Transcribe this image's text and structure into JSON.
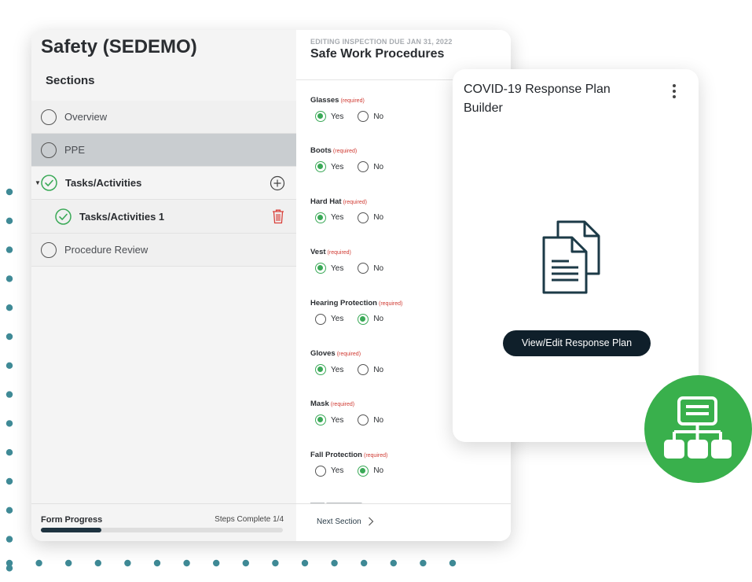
{
  "app": {
    "title": "Safety (SEDEMO)"
  },
  "sidebar": {
    "title": "Sections",
    "items": [
      {
        "label": "Overview",
        "status": "incomplete"
      },
      {
        "label": "PPE",
        "status": "incomplete",
        "selected": true
      },
      {
        "label": "Tasks/Activities",
        "status": "complete",
        "expanded": true,
        "action_icon": "plus-circle-icon"
      },
      {
        "label": "Tasks/Activities 1",
        "status": "complete",
        "child": true,
        "action_icon": "trash-icon"
      },
      {
        "label": "Procedure Review",
        "status": "incomplete"
      }
    ],
    "progress": {
      "label": "Form Progress",
      "steps_text": "Steps Complete 1/4",
      "fraction": 0.25
    }
  },
  "form": {
    "editing_label": "EDITING INSPECTION DUE JAN 31, 2022",
    "title": "Safe Work Procedures",
    "required_text": "(required)",
    "yes_label": "Yes",
    "no_label": "No",
    "questions": [
      {
        "label": "Glasses",
        "answer": "Yes"
      },
      {
        "label": "Boots",
        "answer": "Yes"
      },
      {
        "label": "Hard Hat",
        "answer": "Yes"
      },
      {
        "label": "Vest",
        "answer": "Yes"
      },
      {
        "label": "Hearing Protection",
        "answer": "No"
      },
      {
        "label": "Gloves",
        "answer": "Yes"
      },
      {
        "label": "Mask",
        "answer": "Yes"
      },
      {
        "label": "Fall Protection",
        "answer": "No"
      }
    ],
    "next_label": "Next Section"
  },
  "covid_card": {
    "title": "COVID-19 Response Plan Builder",
    "button_label": "View/Edit Response Plan",
    "icon": "documents-icon"
  },
  "badge": {
    "icon": "hierarchy-icon"
  },
  "colors": {
    "accent_green": "#3aa957",
    "badge_green": "#39b04c",
    "dark_navy": "#0f1f2a",
    "dot_teal": "#3f8a96",
    "required_red": "#d03a32",
    "trash_red": "#d9403a"
  }
}
